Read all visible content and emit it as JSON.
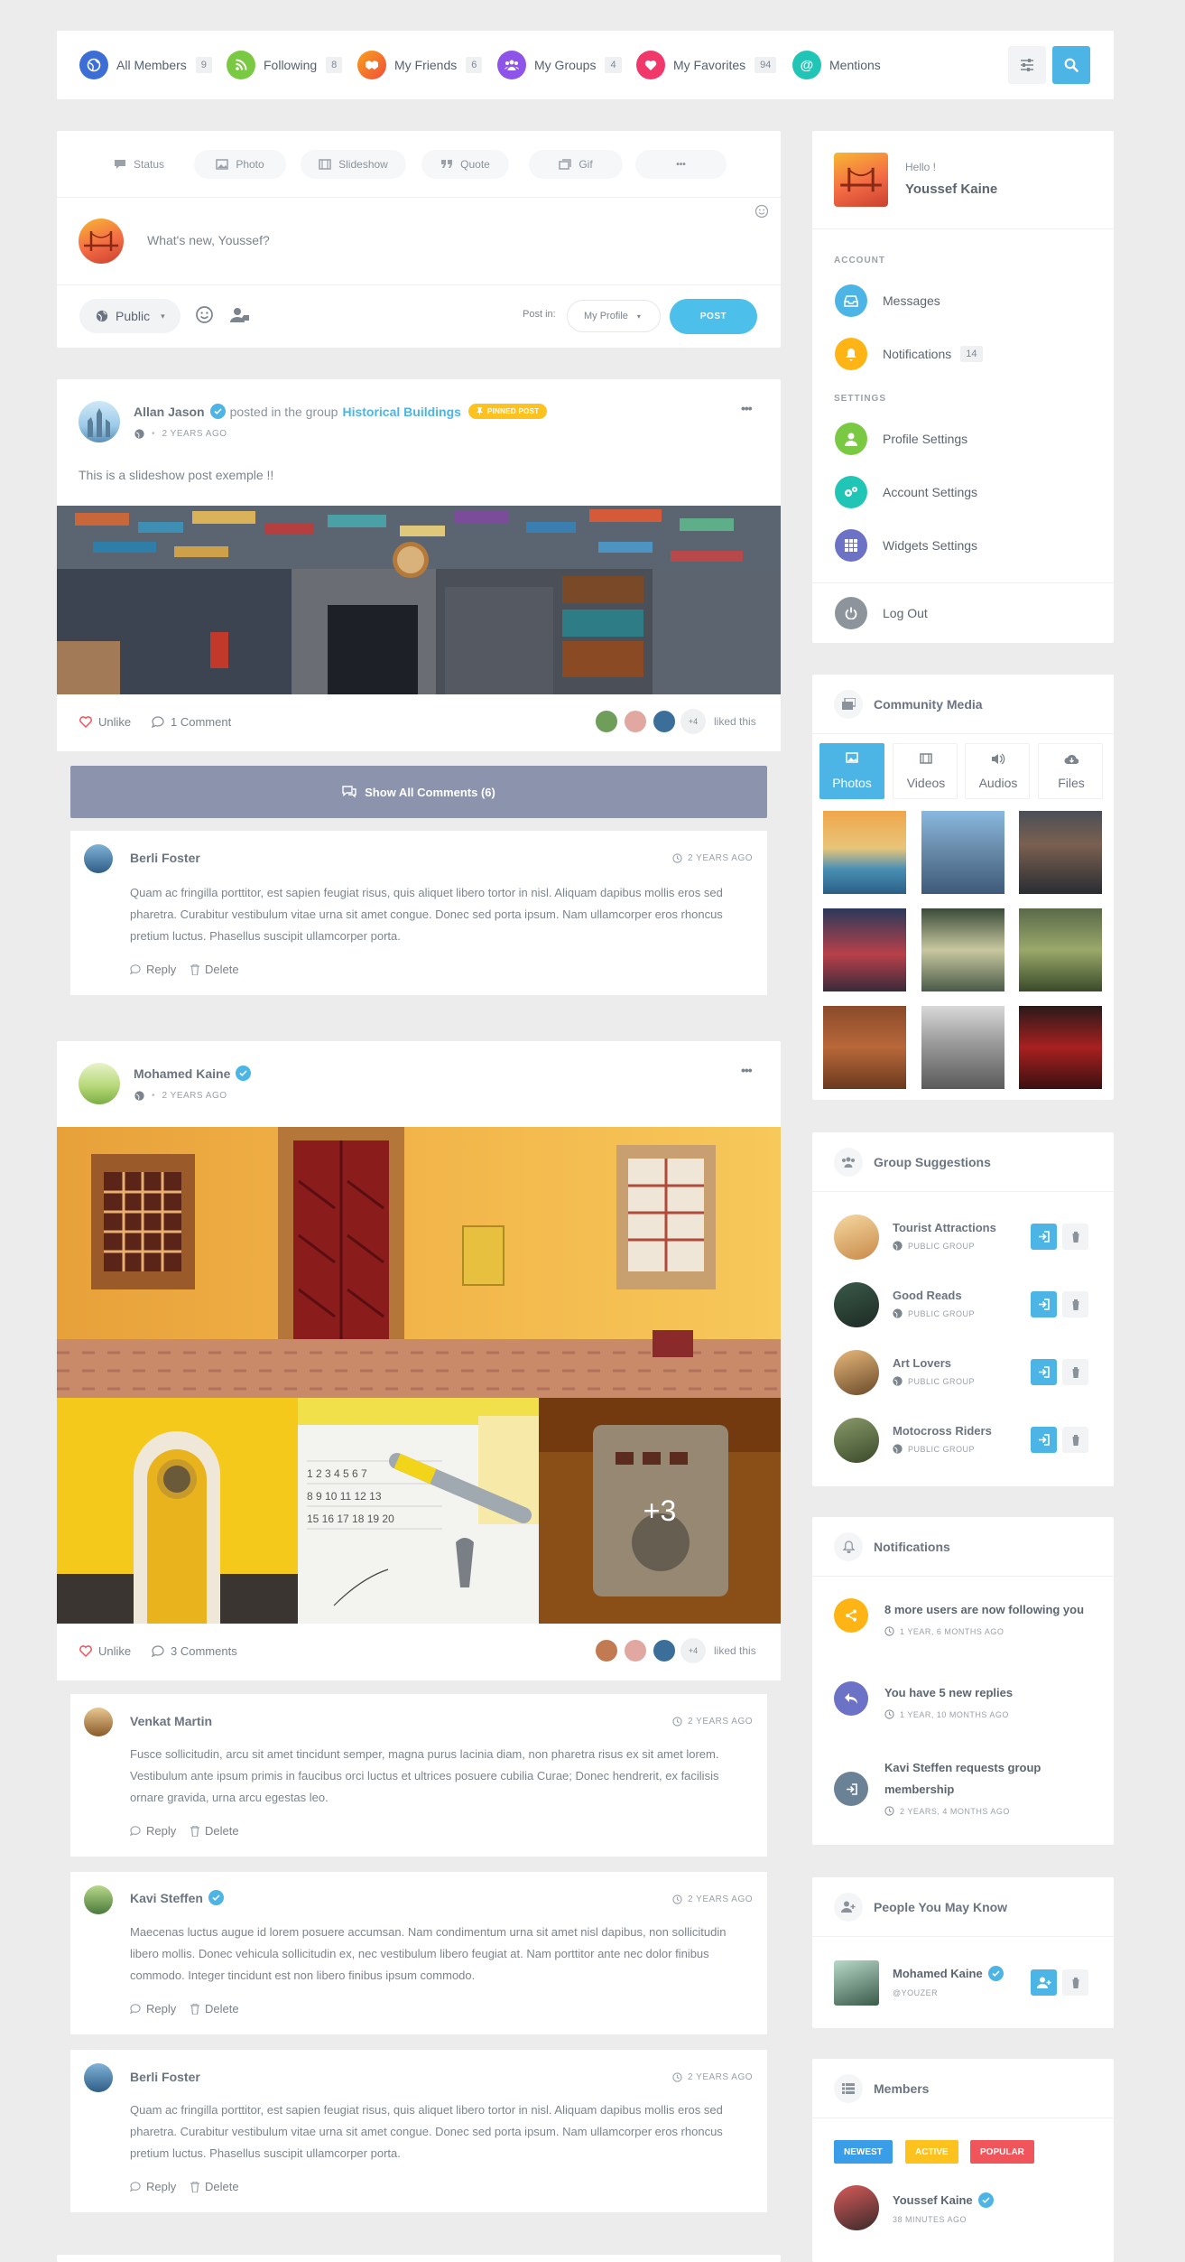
{
  "colors": {
    "accent": "#4cb5e5",
    "page_bg": "#ececec",
    "unlike_red": "#f0555c",
    "show_comments_bg": "#8c94ad",
    "pinned_yellow": "#fdc21d"
  },
  "topnav": {
    "items": [
      {
        "label": "All Members",
        "count": "9",
        "icon": "globe-icon",
        "color": "#3c6ed6"
      },
      {
        "label": "Following",
        "count": "8",
        "icon": "rss-icon",
        "color": "#7ac943"
      },
      {
        "label": "My Friends",
        "count": "6",
        "icon": "handshake-icon",
        "color": "#f76b2b"
      },
      {
        "label": "My Groups",
        "count": "4",
        "icon": "users-icon",
        "color": "#8e54e9"
      },
      {
        "label": "My Favorites",
        "count": "94",
        "icon": "heart-icon",
        "color": "#f0386b"
      },
      {
        "label": "Mentions",
        "count": "",
        "icon": "at-icon",
        "color": "#20c5b6"
      }
    ]
  },
  "composer": {
    "tabs": [
      "Status",
      "Photo",
      "Slideshow",
      "Quote",
      "Gif",
      "•••"
    ],
    "placeholder": "What's new, Youssef?",
    "privacy": "Public",
    "post_in_label": "Post in:",
    "post_in_value": "My Profile",
    "post_button": "POST"
  },
  "post1": {
    "author": "Allan Jason",
    "posted_in": "posted in the group",
    "group": "Historical Buildings",
    "pinned": "PINNED POST",
    "time": "2 YEARS AGO",
    "text": "This is a slideshow post exemple !!",
    "unlike": "Unlike",
    "comments": "1 Comment",
    "liked_count": "+4",
    "liked_text": "liked this",
    "show_comments": "Show All Comments (6)",
    "comment": {
      "author": "Berli Foster",
      "time": "2 YEARS AGO",
      "text": "Quam ac fringilla porttitor, est sapien feugiat risus, quis aliquet libero tortor in nisl. Aliquam dapibus mollis eros sed pharetra. Curabitur vestibulum vitae urna sit amet congue. Donec sed porta ipsum. Nam ullamcorper eros rhoncus pretium luctus. Phasellus suscipit ullamcorper porta.",
      "reply": "Reply",
      "delete": "Delete"
    }
  },
  "post2": {
    "author": "Mohamed Kaine",
    "time": "2 YEARS AGO",
    "more_photos": "+3",
    "unlike": "Unlike",
    "comments": "3 Comments",
    "liked_count": "+4",
    "liked_text": "liked this",
    "comments_list": [
      {
        "author": "Venkat Martin",
        "verified": false,
        "time": "2 YEARS AGO",
        "text": "Fusce sollicitudin, arcu sit amet tincidunt semper, magna purus lacinia diam, non pharetra risus ex sit amet lorem. Vestibulum ante ipsum primis in faucibus orci luctus et ultrices posuere cubilia Curae; Donec hendrerit, ex facilisis ornare gravida, urna arcu egestas leo.",
        "reply": "Reply",
        "delete": "Delete"
      },
      {
        "author": "Kavi Steffen",
        "verified": true,
        "time": "2 YEARS AGO",
        "text": "Maecenas luctus augue id lorem posuere accumsan. Nam condimentum urna sit amet nisl dapibus, non sollicitudin libero mollis. Donec vehicula sollicitudin ex, nec vestibulum libero feugiat at. Nam porttitor ante nec dolor finibus commodo. Integer tincidunt est non libero finibus ipsum commodo.",
        "reply": "Reply",
        "delete": "Delete"
      },
      {
        "author": "Berli Foster",
        "verified": false,
        "time": "2 YEARS AGO",
        "text": "Quam ac fringilla porttitor, est sapien feugiat risus, quis aliquet libero tortor in nisl. Aliquam dapibus mollis eros sed pharetra. Curabitur vestibulum vitae urna sit amet congue. Donec sed porta ipsum. Nam ullamcorper eros rhoncus pretium luctus. Phasellus suscipit ullamcorper porta.",
        "reply": "Reply",
        "delete": "Delete"
      }
    ]
  },
  "account": {
    "hello": "Hello !",
    "name": "Youssef Kaine",
    "section_account": "ACCOUNT",
    "messages": "Messages",
    "notifications": "Notifications",
    "notifications_count": "14",
    "section_settings": "SETTINGS",
    "profile_settings": "Profile Settings",
    "account_settings": "Account Settings",
    "widgets_settings": "Widgets Settings",
    "logout": "Log Out"
  },
  "media": {
    "title": "Community Media",
    "tabs": [
      "Photos",
      "Videos",
      "Audios",
      "Files"
    ]
  },
  "groups": {
    "title": "Group Suggestions",
    "items": [
      {
        "name": "Tourist Attractions",
        "type": "PUBLIC GROUP"
      },
      {
        "name": "Good Reads",
        "type": "PUBLIC GROUP"
      },
      {
        "name": "Art Lovers",
        "type": "PUBLIC GROUP"
      },
      {
        "name": "Motocross Riders",
        "type": "PUBLIC GROUP"
      }
    ]
  },
  "notifs": {
    "title": "Notifications",
    "items": [
      {
        "text": "8 more users are now following you",
        "time": "1 YEAR, 6 MONTHS AGO",
        "color": "#fdb414"
      },
      {
        "text": "You have 5 new replies",
        "time": "1 YEAR, 10 MONTHS AGO",
        "color": "#6c72c5"
      },
      {
        "text": "Kavi Steffen requests group membership",
        "time": "2 YEARS, 4 MONTHS AGO",
        "color": "#6b8196"
      }
    ]
  },
  "people": {
    "title": "People You May Know",
    "name": "Mohamed Kaine",
    "handle": "@YOUZER"
  },
  "members": {
    "title": "Members",
    "filters": [
      "NEWEST",
      "ACTIVE",
      "POPULAR"
    ],
    "name": "Youssef Kaine",
    "time": "38 MINUTES AGO"
  }
}
